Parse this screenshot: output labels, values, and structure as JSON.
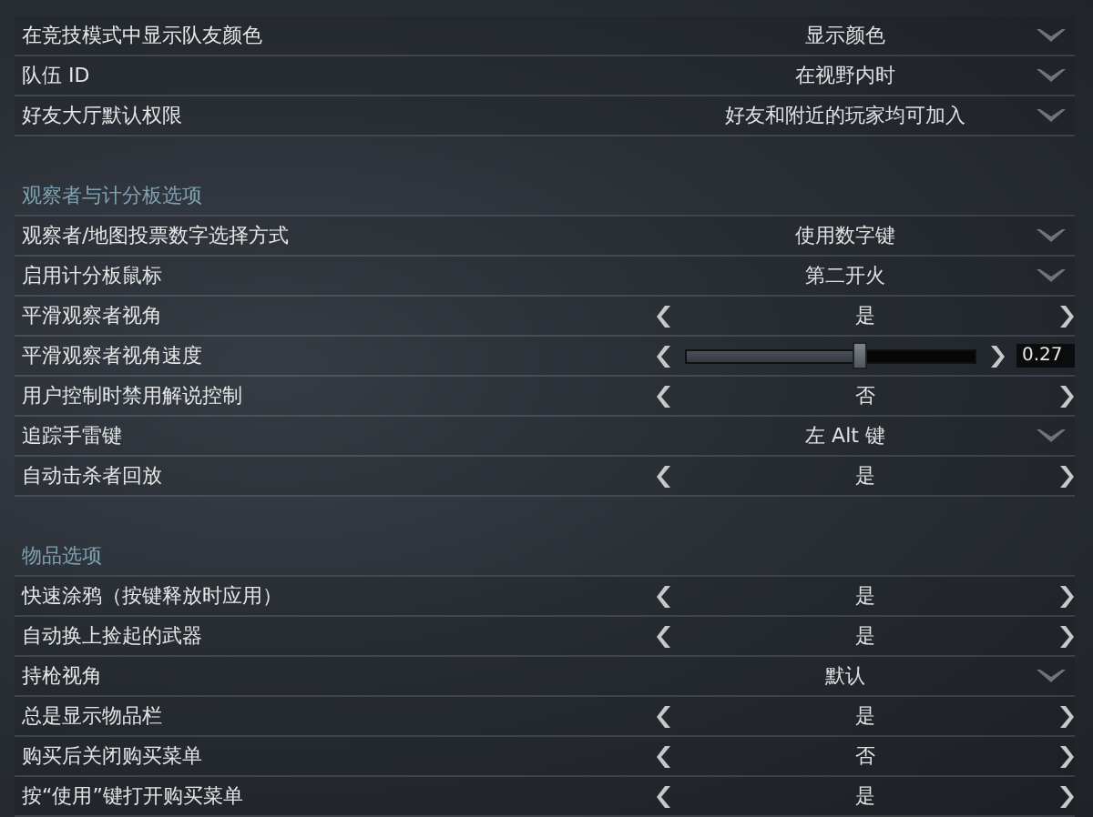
{
  "sections": [
    {
      "rows": [
        {
          "kind": "dropdown",
          "label": "在竞技模式中显示队友颜色",
          "value": "显示颜色"
        },
        {
          "kind": "dropdown",
          "label": "队伍 ID",
          "value": "在视野内时"
        },
        {
          "kind": "dropdown",
          "label": "好友大厅默认权限",
          "value": "好友和附近的玩家均可加入"
        }
      ]
    },
    {
      "title": "观察者与计分板选项",
      "rows": [
        {
          "kind": "dropdown",
          "label": "观察者/地图投票数字选择方式",
          "value": "使用数字键"
        },
        {
          "kind": "dropdown",
          "label": "启用计分板鼠标",
          "value": "第二开火"
        },
        {
          "kind": "toggle",
          "label": "平滑观察者视角",
          "value": "是"
        },
        {
          "kind": "slider",
          "label": "平滑观察者视角速度",
          "level": 0.6,
          "value": "0.27"
        },
        {
          "kind": "toggle",
          "label": "用户控制时禁用解说控制",
          "value": "否"
        },
        {
          "kind": "dropdown",
          "label": "追踪手雷键",
          "value": "左 Alt 键"
        },
        {
          "kind": "toggle",
          "label": "自动击杀者回放",
          "value": "是"
        }
      ]
    },
    {
      "title": "物品选项",
      "rows": [
        {
          "kind": "toggle",
          "label": "快速涂鸦（按键释放时应用）",
          "value": "是"
        },
        {
          "kind": "toggle",
          "label": "自动换上捡起的武器",
          "value": "是"
        },
        {
          "kind": "dropdown",
          "label": "持枪视角",
          "value": "默认"
        },
        {
          "kind": "toggle",
          "label": "总是显示物品栏",
          "value": "是"
        },
        {
          "kind": "toggle",
          "label": "购买后关闭购买菜单",
          "value": "否"
        },
        {
          "kind": "toggle",
          "label": "按“使用”键打开购买菜单",
          "value": "是"
        }
      ]
    }
  ]
}
